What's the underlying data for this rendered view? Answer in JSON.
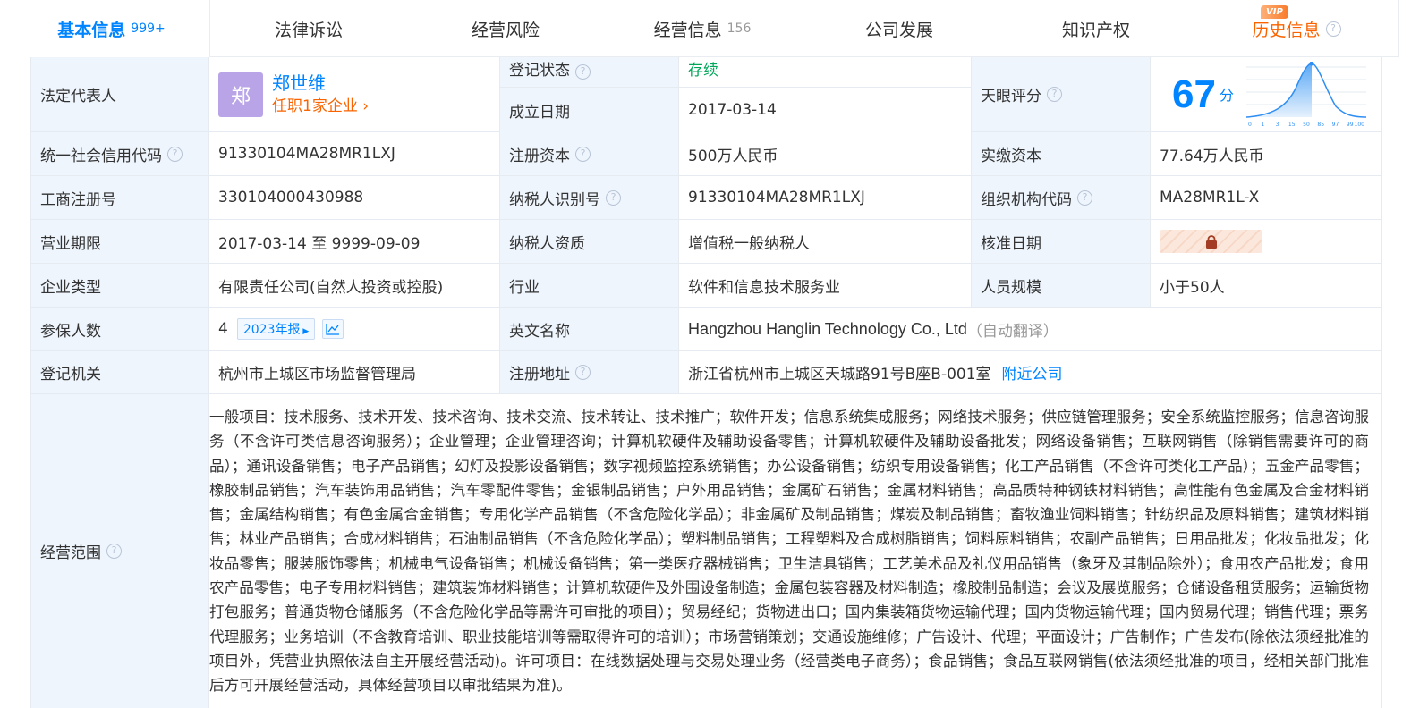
{
  "tabs": [
    {
      "label": "基本信息",
      "count": "999+",
      "active": true
    },
    {
      "label": "法律诉讼",
      "count": ""
    },
    {
      "label": "经营风险",
      "count": ""
    },
    {
      "label": "经营信息",
      "count": "156"
    },
    {
      "label": "公司发展",
      "count": ""
    },
    {
      "label": "知识产权",
      "count": ""
    },
    {
      "label": "历史信息",
      "count": "",
      "badge": "VIP"
    }
  ],
  "rows": {
    "legal_rep": {
      "label": "法定代表人",
      "avatar": "郑",
      "name": "郑世维",
      "sub": "任职1家企业"
    },
    "reg_status": {
      "label": "登记状态",
      "value": "存续"
    },
    "found_date": {
      "label": "成立日期",
      "value": "2017-03-14"
    },
    "tianyan": {
      "label": "天眼评分",
      "score": "67",
      "unit": "分",
      "chart_ticks": [
        "0",
        "1",
        "3",
        "15",
        "50",
        "85",
        "97",
        "99",
        "100"
      ]
    },
    "credit_code": {
      "label": "统一社会信用代码",
      "value": "91330104MA28MR1LXJ"
    },
    "reg_capital": {
      "label": "注册资本",
      "value": "500万人民币"
    },
    "paid_capital": {
      "label": "实缴资本",
      "value": "77.64万人民币"
    },
    "biz_reg_no": {
      "label": "工商注册号",
      "value": "330104000430988"
    },
    "taxpayer_id": {
      "label": "纳税人识别号",
      "value": "91330104MA28MR1LXJ"
    },
    "org_code": {
      "label": "组织机构代码",
      "value": "MA28MR1L-X"
    },
    "biz_term": {
      "label": "营业期限",
      "value": "2017-03-14 至 9999-09-09"
    },
    "taxpayer_qual": {
      "label": "纳税人资质",
      "value": "增值税一般纳税人"
    },
    "approve_date": {
      "label": "核准日期",
      "value": ""
    },
    "ent_type": {
      "label": "企业类型",
      "value": "有限责任公司(自然人投资或控股)"
    },
    "industry": {
      "label": "行业",
      "value": "软件和信息技术服务业"
    },
    "staff": {
      "label": "人员规模",
      "value": "小于50人"
    },
    "insured": {
      "label": "参保人数",
      "value": "4",
      "year_btn": "2023年报"
    },
    "en_name": {
      "label": "英文名称",
      "value": "Hangzhou Hanglin Technology Co., Ltd",
      "note": "（自动翻译）"
    },
    "reg_authority": {
      "label": "登记机关",
      "value": "杭州市上城区市场监督管理局"
    },
    "reg_address": {
      "label": "注册地址",
      "value": "浙江省杭州市上城区天城路91号B座B-001室",
      "link": "附近公司"
    },
    "scope": {
      "label": "经营范围",
      "value": "一般项目：技术服务、技术开发、技术咨询、技术交流、技术转让、技术推广；软件开发；信息系统集成服务；网络技术服务；供应链管理服务；安全系统监控服务；信息咨询服务（不含许可类信息咨询服务）；企业管理；企业管理咨询；计算机软硬件及辅助设备零售；计算机软硬件及辅助设备批发；网络设备销售；互联网销售（除销售需要许可的商品）；通讯设备销售；电子产品销售；幻灯及投影设备销售；数字视频监控系统销售；办公设备销售；纺织专用设备销售；化工产品销售（不含许可类化工产品）；五金产品零售；橡胶制品销售；汽车装饰用品销售；汽车零配件零售；金银制品销售；户外用品销售；金属矿石销售；金属材料销售；高品质特种钢铁材料销售；高性能有色金属及合金材料销售；金属结构销售；有色金属合金销售；专用化学产品销售（不含危险化学品）；非金属矿及制品销售；煤炭及制品销售；畜牧渔业饲料销售；针纺织品及原料销售；建筑材料销售；林业产品销售；合成材料销售；石油制品销售（不含危险化学品）；塑料制品销售；工程塑料及合成树脂销售；饲料原料销售；农副产品销售；日用品批发；化妆品批发；化妆品零售；服装服饰零售；机械电气设备销售；机械设备销售；第一类医疗器械销售；卫生洁具销售；工艺美术品及礼仪用品销售（象牙及其制品除外）；食用农产品批发；食用农产品零售；电子专用材料销售；建筑装饰材料销售；计算机软硬件及外围设备制造；金属包装容器及材料制造；橡胶制品制造；会议及展览服务；仓储设备租赁服务；运输货物打包服务；普通货物仓储服务（不含危险化学品等需许可审批的项目）；贸易经纪；货物进出口；国内集装箱货物运输代理；国内货物运输代理；国内贸易代理；销售代理；票务代理服务；业务培训（不含教育培训、职业技能培训等需取得许可的培训）；市场营销策划；交通设施维修；广告设计、代理；平面设计；广告制作；广告发布(除依法须经批准的项目外，凭营业执照依法自主开展经营活动)。许可项目：在线数据处理与交易处理业务（经营类电子商务）；食品销售；食品互联网销售(依法须经批准的项目，经相关部门批准后方可开展经营活动，具体经营项目以审批结果为准)。"
    }
  },
  "colors": {
    "accent": "#0084ff",
    "orange": "#fa6400",
    "status_green": "#00a65a",
    "label_bg": "#eef5fd"
  }
}
